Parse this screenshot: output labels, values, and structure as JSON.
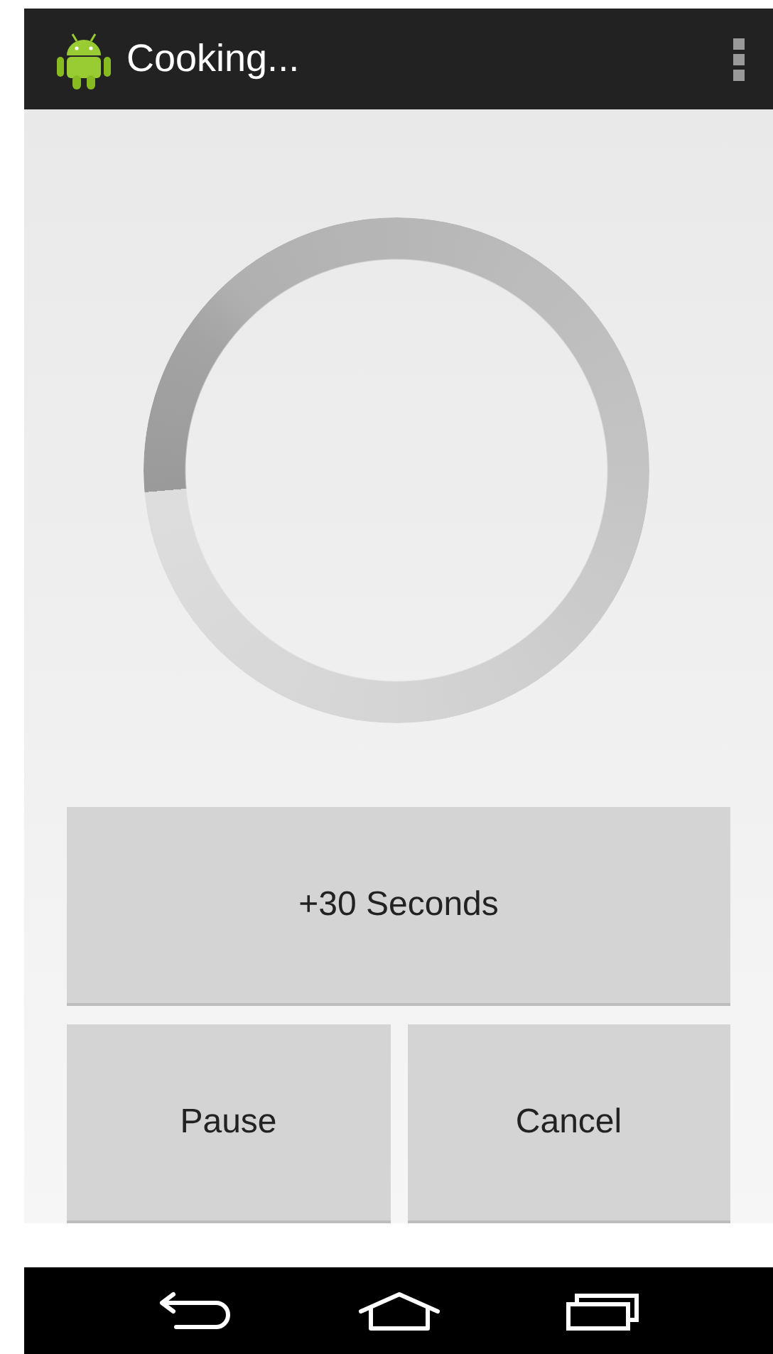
{
  "action_bar": {
    "title": "Cooking..."
  },
  "buttons": [
    {
      "label": "+30 Seconds"
    },
    {
      "label": "Pause"
    },
    {
      "label": "Cancel"
    }
  ]
}
